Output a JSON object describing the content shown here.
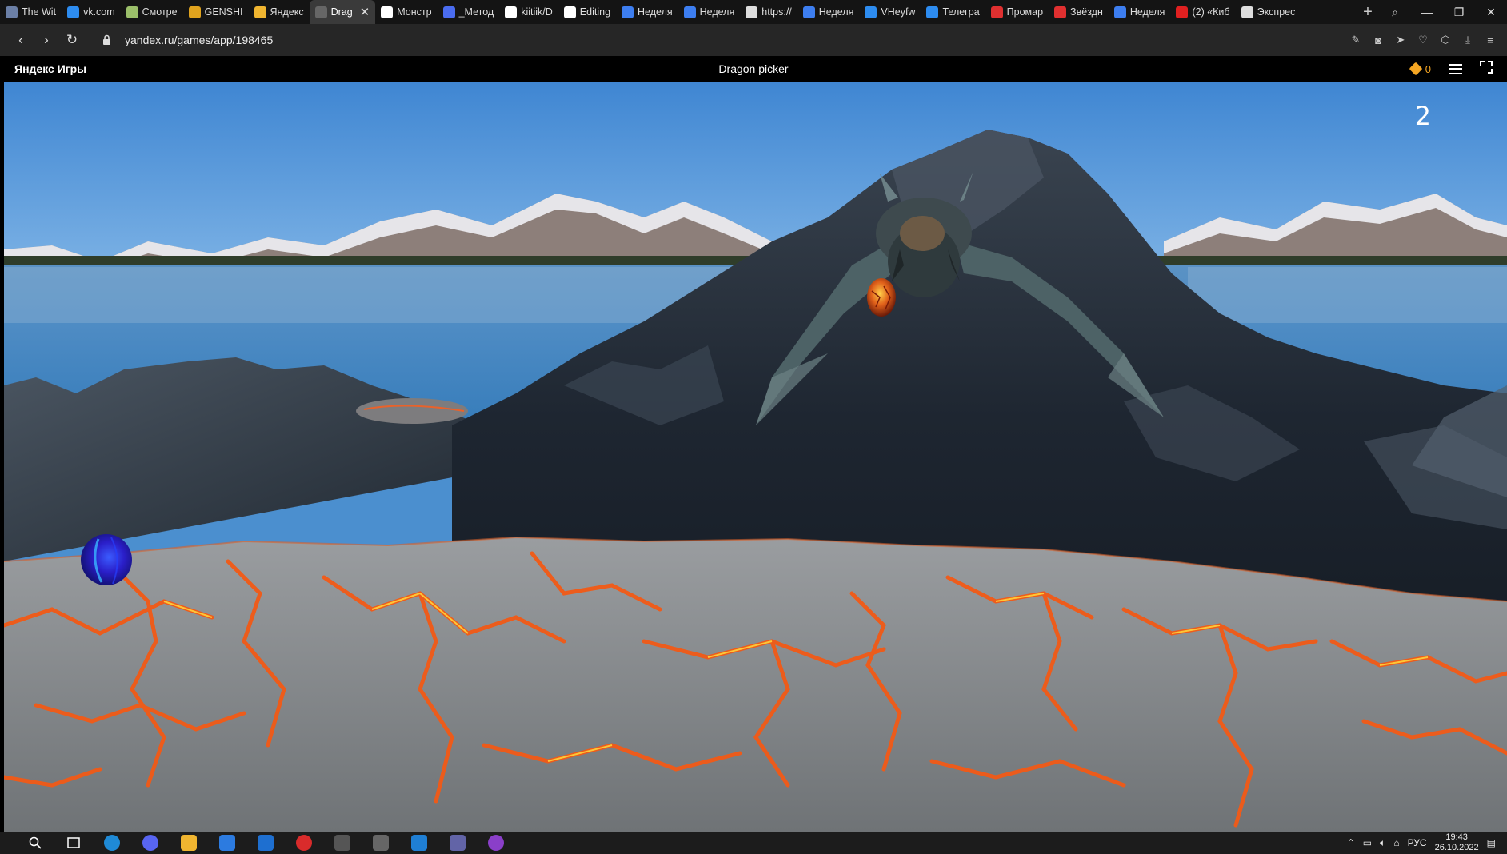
{
  "browser": {
    "tabs": [
      {
        "label": "The Wit",
        "icon": "page-icon",
        "color": "#6b7fa6"
      },
      {
        "label": "vk.com",
        "icon": "chat-icon",
        "color": "#2d8cf0"
      },
      {
        "label": "Смотре",
        "icon": "face-icon",
        "color": "#9bbf6a"
      },
      {
        "label": "GENSHI",
        "icon": "g-letter-icon",
        "color": "#e0a31e"
      },
      {
        "label": "Яндекс",
        "icon": "games-icon",
        "color": "#f0b530"
      },
      {
        "label": "Drag",
        "icon": "game-icon",
        "color": "#666666",
        "active": true
      },
      {
        "label": "Монстр",
        "icon": "book-icon",
        "color": "#ffffff"
      },
      {
        "label": "_Метод",
        "icon": "doc-icon",
        "color": "#4a6cf0"
      },
      {
        "label": "kiitiik/D",
        "icon": "github-icon",
        "color": "#ffffff"
      },
      {
        "label": "Editing",
        "icon": "github-icon",
        "color": "#ffffff"
      },
      {
        "label": "Неделя",
        "icon": "wave-icon",
        "color": "#3d7ef0"
      },
      {
        "label": "Неделя",
        "icon": "wave-icon",
        "color": "#3d7ef0"
      },
      {
        "label": "https://",
        "icon": "globe-icon",
        "color": "#dddddd"
      },
      {
        "label": "Неделя",
        "icon": "wave-icon",
        "color": "#3d7ef0"
      },
      {
        "label": "VHeyfw",
        "icon": "vk-icon",
        "color": "#2d8cf0"
      },
      {
        "label": "Телегра",
        "icon": "chat-icon",
        "color": "#2d8cf0"
      },
      {
        "label": "Промар",
        "icon": "letter-a-icon",
        "color": "#e03030"
      },
      {
        "label": "Звёздн",
        "icon": "letter-a-icon",
        "color": "#e03030"
      },
      {
        "label": "Неделя",
        "icon": "wave-icon",
        "color": "#3d7ef0"
      },
      {
        "label": "(2) «Киб",
        "icon": "youtube-icon",
        "color": "#e02020"
      },
      {
        "label": "Экспрес",
        "icon": "grid-icon",
        "color": "#dddddd"
      }
    ],
    "active_tab_close": "✕",
    "new_tab": "+",
    "window_controls": {
      "search": "⌕",
      "minimize": "—",
      "restore": "❐",
      "close": "✕"
    },
    "nav": {
      "back": "‹",
      "forward": "›",
      "reload": "↻"
    },
    "url": "yandex.ru/games/app/198465"
  },
  "yandex_games": {
    "logo": "Яндекс Игры",
    "game_title": "Dragon picker",
    "coins": "0"
  },
  "game": {
    "score": "2"
  },
  "taskbar": {
    "language": "РУС",
    "time": "19:43",
    "date": "26.10.2022"
  }
}
